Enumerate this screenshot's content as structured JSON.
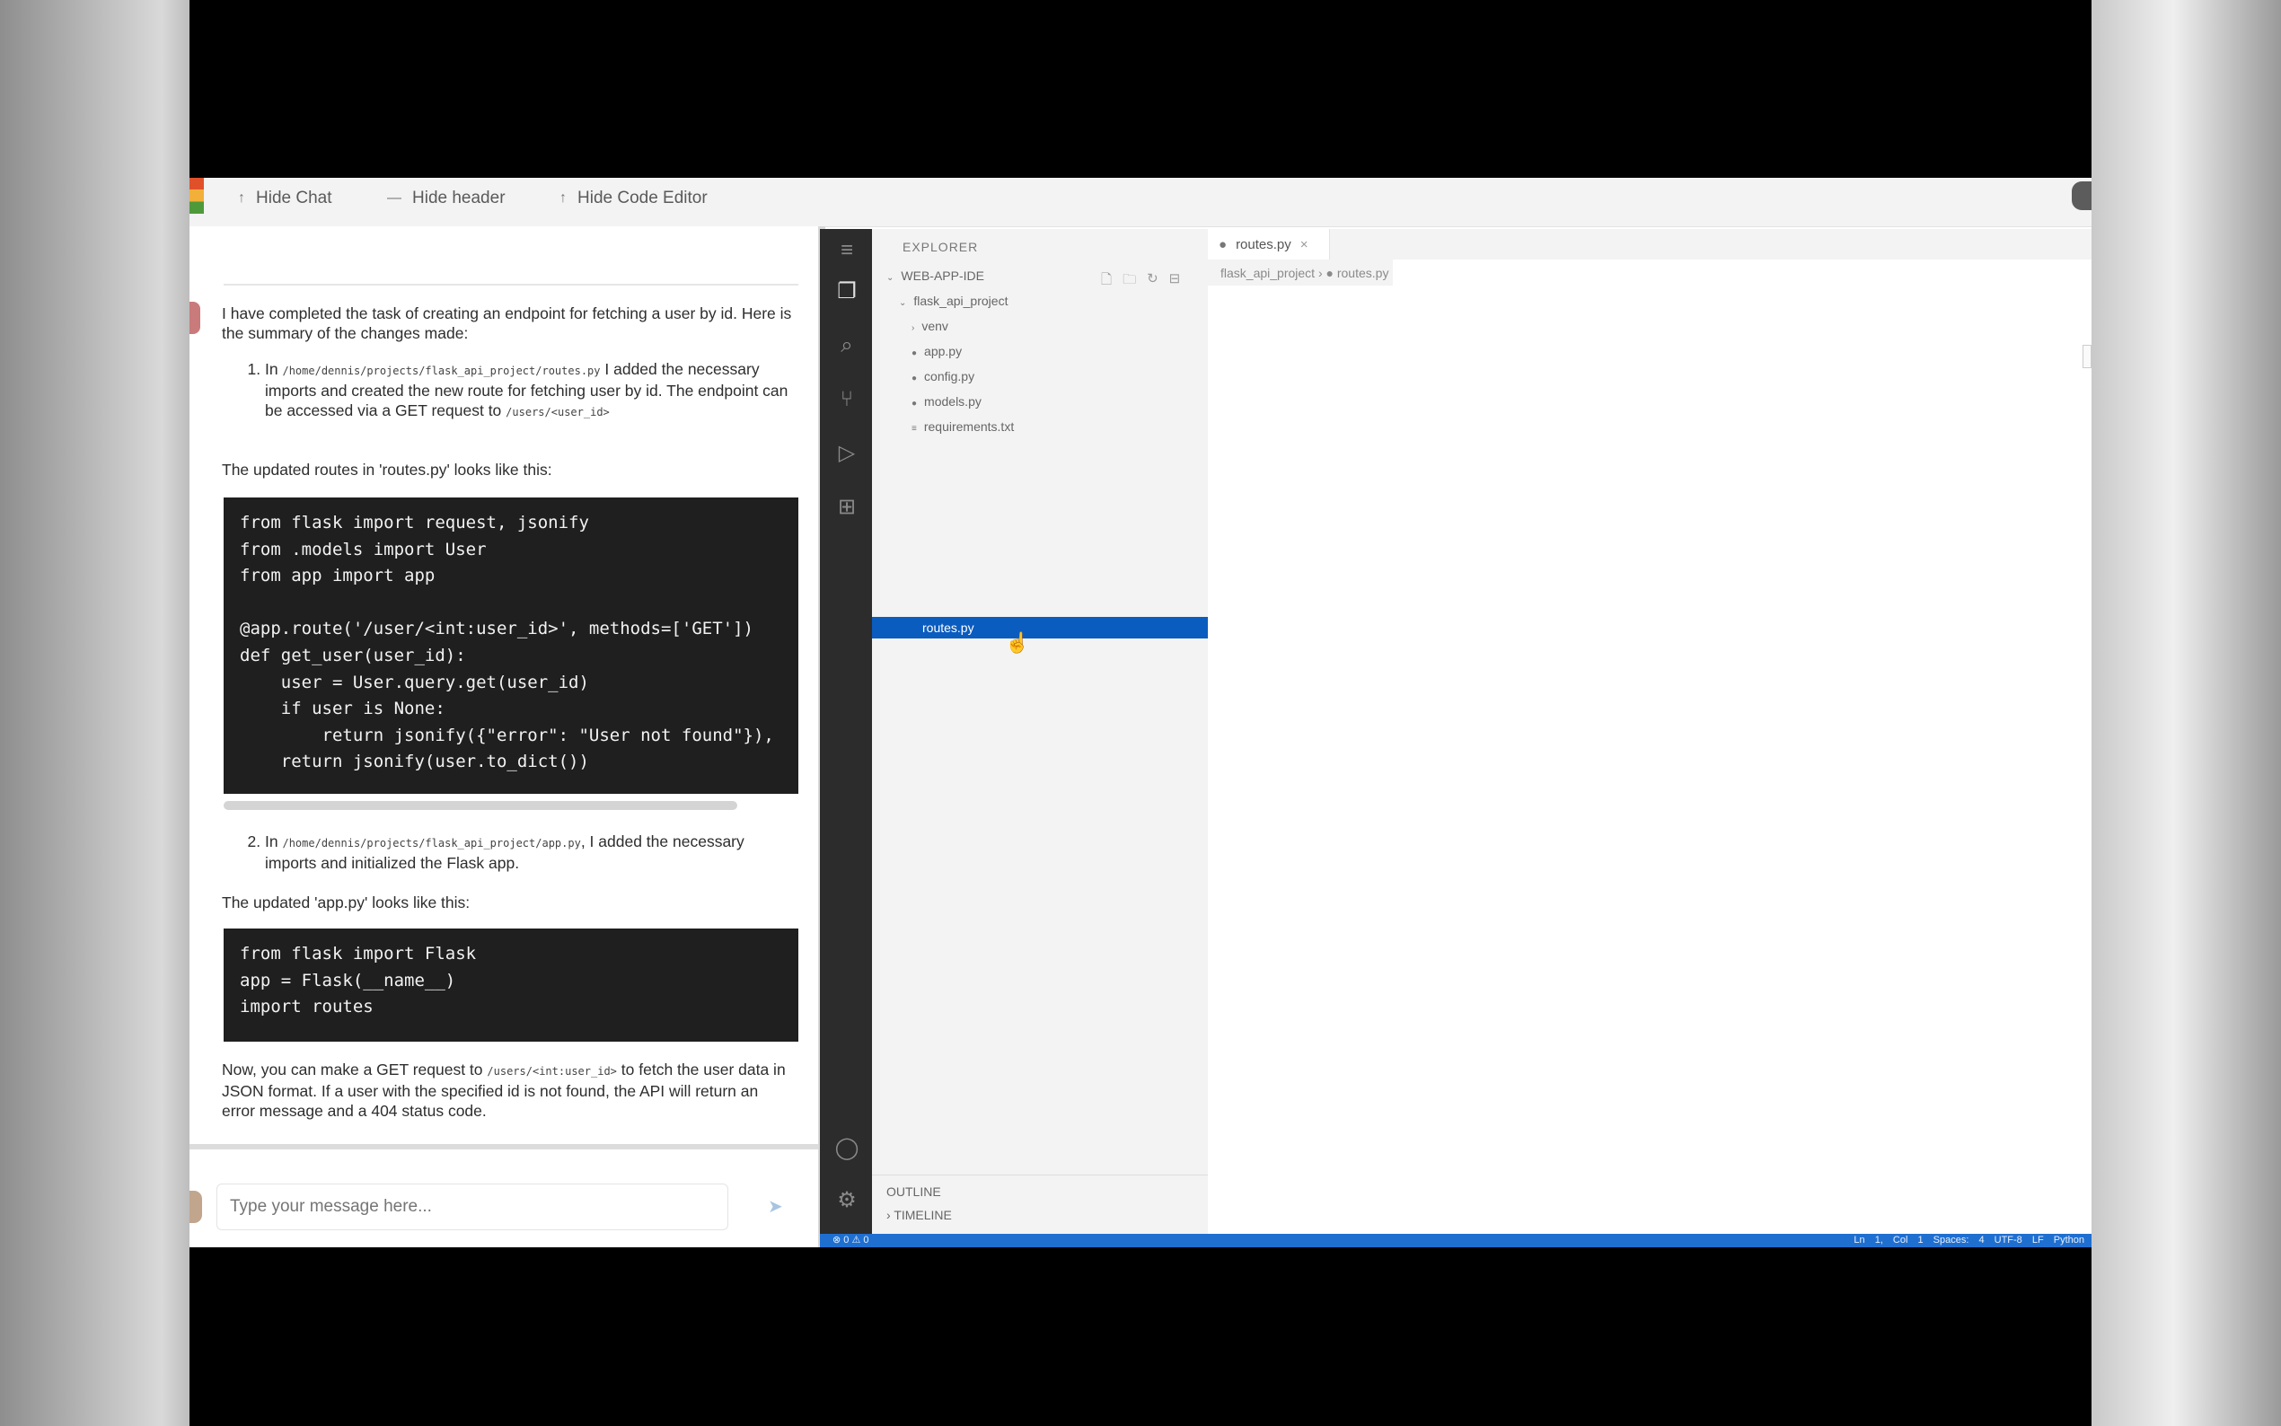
{
  "toolbar": {
    "hide_chat": "Hide Chat",
    "hide_header": "Hide header",
    "hide_code_editor": "Hide Code Editor"
  },
  "chat": {
    "intro": "I have completed the task of creating an endpoint for fetching a user by id. Here is the summary of the changes made:",
    "step1_prefix": "In",
    "step1_path": "/home/dennis/projects/flask_api_project/routes.py",
    "step1_text": "I added the necessary imports and created the new route for fetching user by id. The endpoint can be accessed via a GET request to",
    "step1_endpoint": "/users/<user_id>",
    "routes_caption": "The updated routes in 'routes.py' looks like this:",
    "code_routes": "from flask import request, jsonify\nfrom .models import User\nfrom app import app\n\n@app.route('/user/<int:user_id>', methods=['GET'])\ndef get_user(user_id):\n    user = User.query.get(user_id)\n    if user is None:\n        return jsonify({\"error\": \"User not found\"}),\n    return jsonify(user.to_dict())",
    "step2_prefix": "In",
    "step2_path": "/home/dennis/projects/flask_api_project/app.py",
    "step2_text": ", I added the necessary imports and initialized the Flask app.",
    "app_caption": "The updated 'app.py' looks like this:",
    "code_app": "from flask import Flask\napp = Flask(__name__)\nimport routes",
    "outro_prefix": "Now, you can make a GET request to",
    "outro_path": "/users/<int:user_id>",
    "outro_text": "to fetch the user data in JSON format. If a user with the specified id is not found, the API will return an error message and a 404 status code.",
    "input_placeholder": "Type your message here..."
  },
  "explorer": {
    "title": "EXPLORER",
    "root": "WEB-APP-IDE",
    "project": "flask_api_project",
    "items": [
      "venv",
      "app.py",
      "config.py",
      "models.py",
      "requirements.txt",
      "routes.py"
    ],
    "selected": "routes.py",
    "outline": "OUTLINE",
    "timeline": "TIMELINE"
  },
  "editor": {
    "tab": "routes.py",
    "breadcrumb_project": "flask_api_project",
    "breadcrumb_file": "routes.py"
  },
  "statusbar": {
    "left": "⊗ 0 ⚠ 0",
    "right": "Ln 1, Col 1 Spaces: 4 UTF-8 LF Python"
  },
  "colors": {
    "accent": "#1f6fd1",
    "selection": "#0b5cbf",
    "activity_bar": "#2c2c2c",
    "code_bg": "#1f1f1f"
  }
}
